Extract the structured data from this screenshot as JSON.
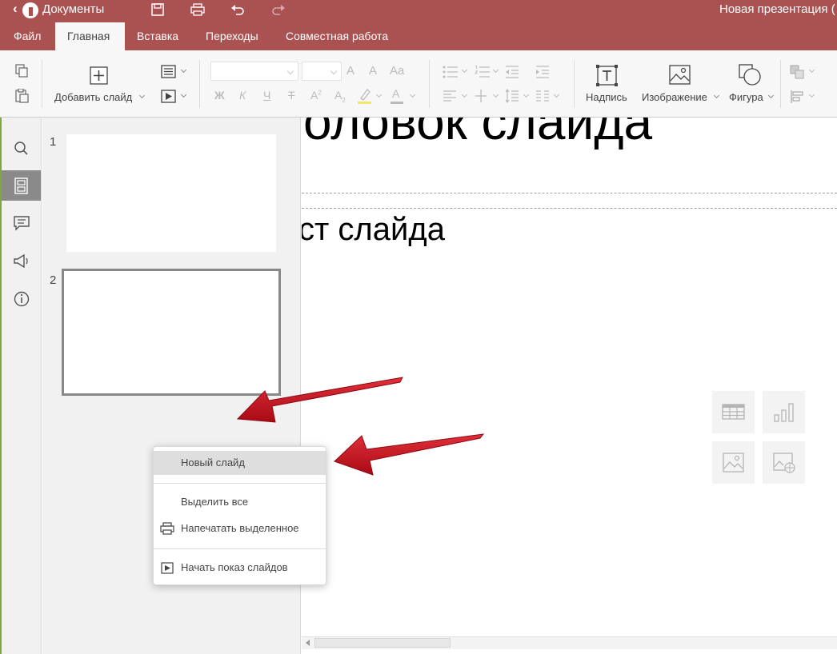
{
  "titlebar": {
    "app_name": "Документы",
    "document_title": "Новая презентация ("
  },
  "tabs": [
    {
      "label": "Файл",
      "active": false
    },
    {
      "label": "Главная",
      "active": true
    },
    {
      "label": "Вставка",
      "active": false
    },
    {
      "label": "Переходы",
      "active": false
    },
    {
      "label": "Совместная работа",
      "active": false
    }
  ],
  "toolbar": {
    "add_slide": "Добавить слайд",
    "font_name": "",
    "font_size": "",
    "bold": "Ж",
    "italic": "К",
    "underline": "Ч",
    "strike": "Т",
    "superscript": "A",
    "superscript_mark": "2",
    "subscript": "A",
    "subscript_mark": "2",
    "increase_font": "A",
    "decrease_font": "A",
    "change_case": "Aa",
    "text_color": "A",
    "caption": "Надпись",
    "image": "Изображение",
    "shape": "Фигура"
  },
  "thumbnails": [
    {
      "number": "1"
    },
    {
      "number": "2",
      "selected": true
    }
  ],
  "slide": {
    "title_fragment": "оловок слайда",
    "body_fragment": "ст слайда"
  },
  "context_menu": {
    "items": [
      {
        "label": "Новый слайд",
        "highlighted": true
      },
      {
        "label": "Выделить все"
      },
      {
        "label": "Напечатать выделенное",
        "icon": "printer-icon"
      },
      {
        "label": "Начать показ слайдов",
        "icon": "play-icon"
      }
    ]
  },
  "colors": {
    "brand": "#aa5252",
    "annotation_arrow": "#c8101e",
    "active_sidebar": "#8a8a8a"
  }
}
